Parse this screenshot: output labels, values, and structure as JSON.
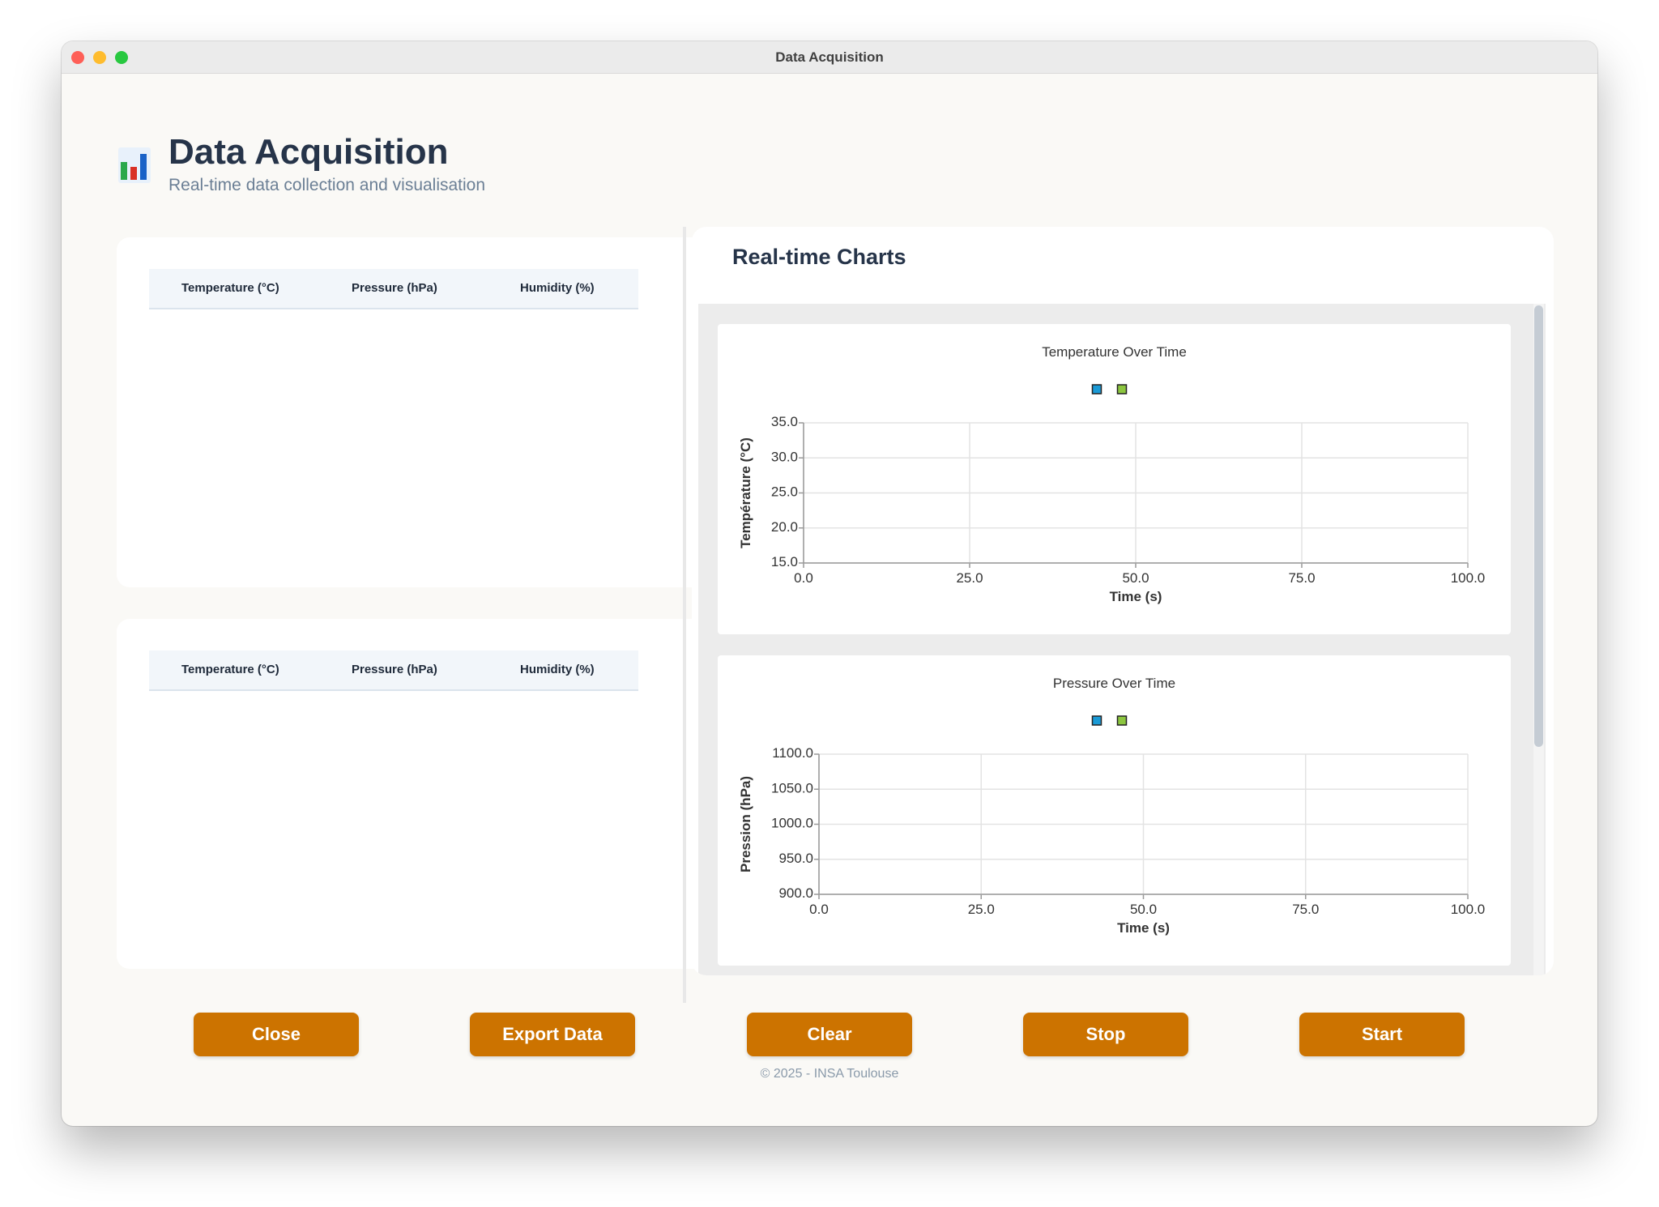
{
  "window": {
    "title": "Data Acquisition"
  },
  "header": {
    "title": "Data Acquisition",
    "subtitle": "Real-time data collection and visualisation",
    "logo_icon": "bar-chart-icon"
  },
  "tables": [
    {
      "columns": [
        "Temperature (°C)",
        "Pressure (hPa)",
        "Humidity (%)"
      ],
      "rows": []
    },
    {
      "columns": [
        "Temperature (°C)",
        "Pressure (hPa)",
        "Humidity (%)"
      ],
      "rows": []
    }
  ],
  "charts_panel": {
    "title": "Real-time Charts"
  },
  "chart_data": [
    {
      "type": "line",
      "title": "Temperature Over Time",
      "xlabel": "Time (s)",
      "ylabel": "Température (°C)",
      "xlim": [
        0,
        100
      ],
      "ylim": [
        15,
        35
      ],
      "xticks": [
        "0.0",
        "25.0",
        "50.0",
        "75.0",
        "100.0"
      ],
      "yticks": [
        "15.0",
        "20.0",
        "25.0",
        "30.0",
        "35.0"
      ],
      "grid": true,
      "legend": "top-center",
      "series": [
        {
          "values": [],
          "color": "#1a9ad6"
        },
        {
          "values": [],
          "color": "#8cc63f"
        }
      ]
    },
    {
      "type": "line",
      "title": "Pressure Over Time",
      "xlabel": "Time (s)",
      "ylabel": "Pression (hPa)",
      "xlim": [
        0,
        100
      ],
      "ylim": [
        900,
        1100
      ],
      "xticks": [
        "0.0",
        "25.0",
        "50.0",
        "75.0",
        "100.0"
      ],
      "yticks": [
        "900.0",
        "950.0",
        "1000.0",
        "1050.0",
        "1100.0"
      ],
      "grid": true,
      "legend": "top-center",
      "series": [
        {
          "values": [],
          "color": "#1a9ad6"
        },
        {
          "values": [],
          "color": "#8cc63f"
        }
      ]
    }
  ],
  "buttons": {
    "close": "Close",
    "export": "Export Data",
    "clear": "Clear",
    "stop": "Stop",
    "start": "Start"
  },
  "footer": "© 2025 - INSA Toulouse",
  "colors": {
    "accent": "#cc7300",
    "title": "#263449",
    "subtitle": "#6b7f95",
    "series_blue": "#1a9ad6",
    "series_green": "#8cc63f"
  }
}
